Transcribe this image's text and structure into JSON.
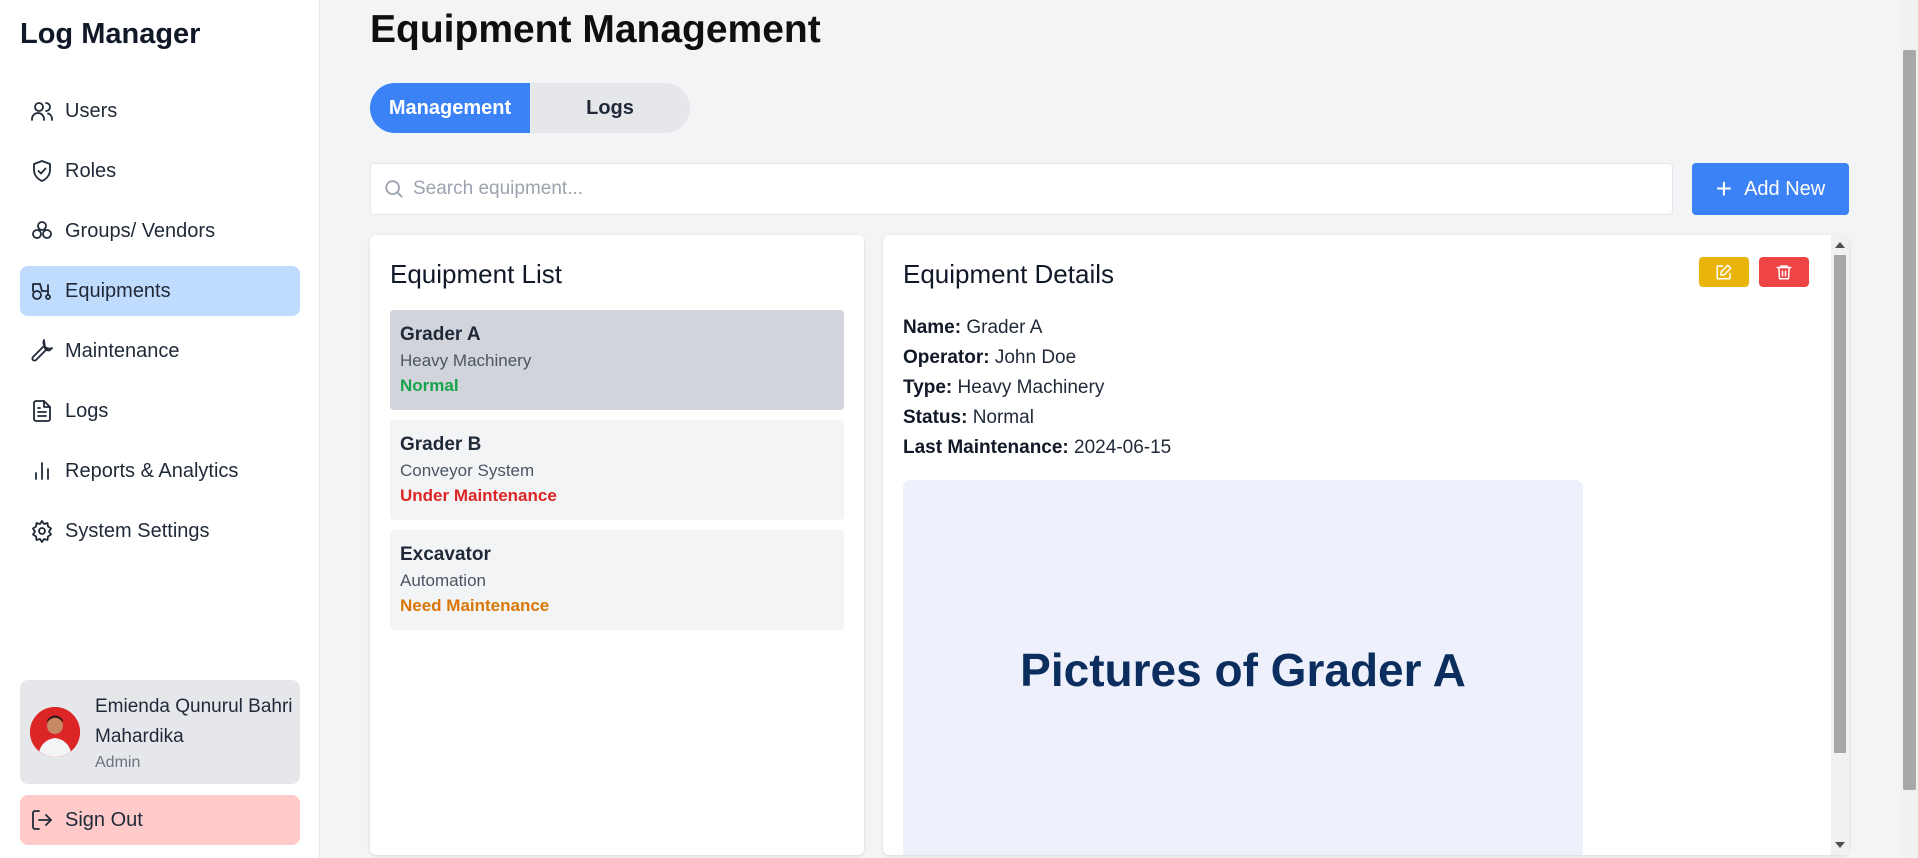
{
  "sidebar": {
    "brand": "Log Manager",
    "items": [
      {
        "label": "Users",
        "icon": "users-icon"
      },
      {
        "label": "Roles",
        "icon": "shield-check-icon"
      },
      {
        "label": "Groups/ Vendors",
        "icon": "groups-icon"
      },
      {
        "label": "Equipments",
        "icon": "tractor-icon",
        "active": true
      },
      {
        "label": "Maintenance",
        "icon": "wrench-icon"
      },
      {
        "label": "Logs",
        "icon": "document-icon"
      },
      {
        "label": "Reports & Analytics",
        "icon": "bar-chart-icon"
      },
      {
        "label": "System Settings",
        "icon": "gear-icon"
      }
    ],
    "user": {
      "name": "Emienda Qunurul Bahri Mahardika",
      "role": "Admin"
    },
    "signout_label": "Sign Out"
  },
  "header": {
    "title": "Equipment Management"
  },
  "tabs": [
    {
      "label": "Management",
      "active": true
    },
    {
      "label": "Logs",
      "active": false
    }
  ],
  "search": {
    "placeholder": "Search equipment...",
    "value": ""
  },
  "add_button": {
    "label": "Add New"
  },
  "equipment_list": {
    "title": "Equipment List",
    "items": [
      {
        "name": "Grader A",
        "type": "Heavy Machinery",
        "status": "Normal",
        "status_color": "#16a34a",
        "selected": true
      },
      {
        "name": "Grader B",
        "type": "Conveyor System",
        "status": "Under Maintenance",
        "status_color": "#dc2626",
        "selected": false
      },
      {
        "name": "Excavator",
        "type": "Automation",
        "status": "Need Maintenance",
        "status_color": "#d97706",
        "selected": false
      }
    ]
  },
  "details": {
    "title": "Equipment Details",
    "fields": [
      {
        "label": "Name:",
        "value": "Grader A"
      },
      {
        "label": "Operator:",
        "value": "John Doe"
      },
      {
        "label": "Type:",
        "value": "Heavy Machinery"
      },
      {
        "label": "Status:",
        "value": "Normal"
      },
      {
        "label": "Last Maintenance:",
        "value": "2024-06-15"
      }
    ],
    "picture_caption": "Pictures of Grader A"
  },
  "colors": {
    "accent": "#3b82f6",
    "edit": "#eab308",
    "delete": "#ef4444",
    "active_nav": "#bfdbfe",
    "signout_bg": "#fecaca"
  }
}
